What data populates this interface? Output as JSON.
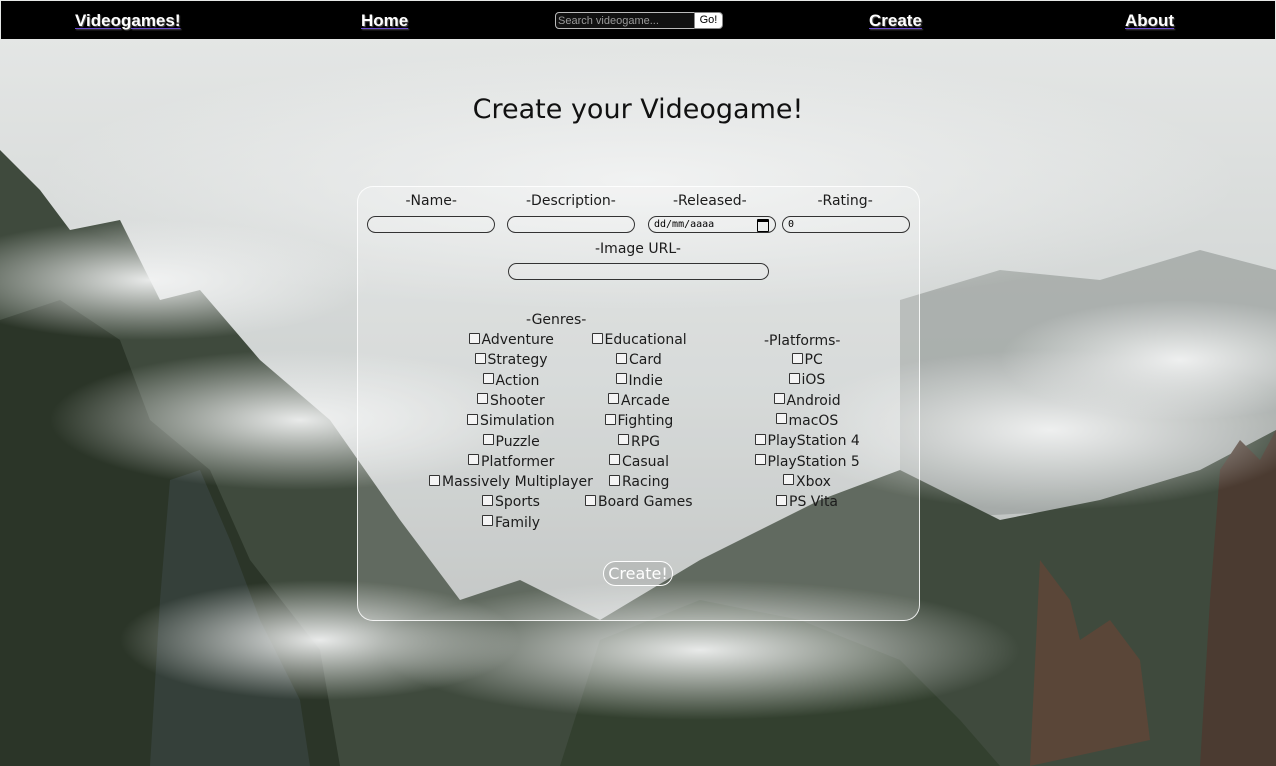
{
  "navbar": {
    "brand": "Videogames!",
    "home": "Home",
    "create": "Create",
    "about": "About",
    "search_placeholder": "Search videogame...",
    "search_button": "Go!"
  },
  "page": {
    "title": "Create your Videogame!"
  },
  "form": {
    "name_label": "-Name-",
    "description_label": "-Description-",
    "released_label": "-Released-",
    "released_value": "dd/mm/aaaa",
    "rating_label": "-Rating-",
    "rating_value": "0",
    "image_label": "-Image URL-",
    "genres_label": "-Genres-",
    "platforms_label": "-Platforms-",
    "genres_col1": [
      "Adventure",
      "Strategy",
      "Action",
      "Shooter",
      "Simulation",
      "Puzzle",
      "Platformer",
      "Massively Multiplayer",
      "Sports",
      "Family"
    ],
    "genres_col2": [
      "Educational",
      "Card",
      "Indie",
      "Arcade",
      "Fighting",
      "RPG",
      "Casual",
      "Racing",
      "Board Games"
    ],
    "platforms": [
      "PC",
      "iOS",
      "Android",
      "macOS",
      "PlayStation 4",
      "PlayStation 5",
      "Xbox",
      "PS Vita"
    ],
    "submit": "Create!"
  },
  "colors": {
    "navbar": "#000000",
    "link_underline": "#6a4bd6"
  }
}
